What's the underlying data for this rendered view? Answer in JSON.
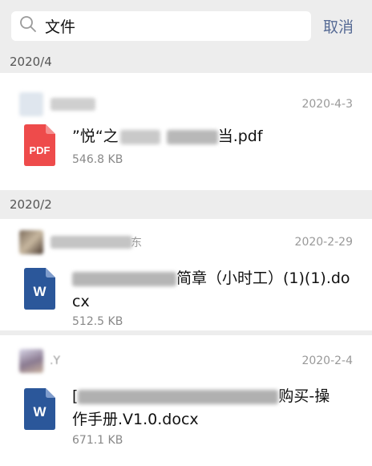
{
  "search": {
    "value": "文件",
    "cancel_label": "取消"
  },
  "sections": [
    {
      "header": "2020/4",
      "items": [
        {
          "sender_date": "2020-4-3",
          "file_icon_label": "PDF",
          "file_name_prefix": "”悦“之",
          "file_name_suffix": "当.pdf",
          "file_size": "546.8 KB"
        }
      ]
    },
    {
      "header": "2020/2",
      "items": [
        {
          "sender_name_visible": "东",
          "sender_date": "2020-2-29",
          "file_icon_label": "W",
          "file_name_suffix": "简章（小时工）(1)(1).docx",
          "file_size": "512.5 KB"
        },
        {
          "sender_name_visible": ".Y",
          "sender_date": "2020-2-4",
          "file_icon_label": "W",
          "file_name_prefix": "[",
          "file_name_suffix": "购买-操",
          "file_name_line2": "作手册.V1.0.docx",
          "file_size": "671.1 KB"
        }
      ]
    }
  ],
  "colors": {
    "pdf_red": "#ee4b4b",
    "word_blue": "#2b579a",
    "link_blue": "#576b95"
  },
  "icons": {
    "search": "search-icon",
    "pdf": "pdf-file-icon",
    "word": "word-file-icon"
  }
}
